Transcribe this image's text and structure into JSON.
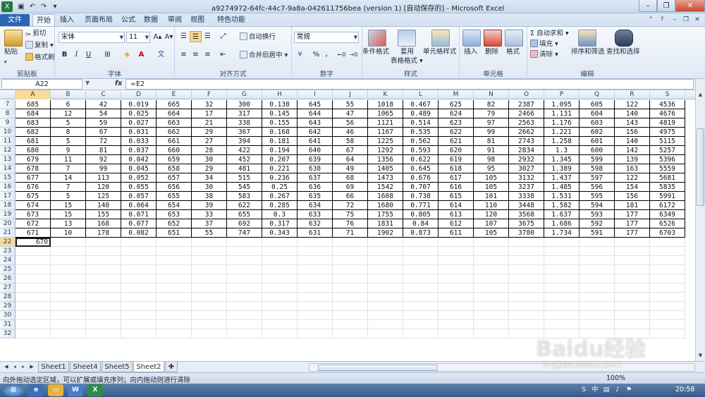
{
  "window": {
    "title": "a9274972-64fc-44c7-9a8a-042611756bea (version 1) [自动保存的] - Microsoft Excel",
    "minimize": "–",
    "restore": "❐",
    "close": "✕"
  },
  "tabs": [
    "文件",
    "开始",
    "插入",
    "页面布局",
    "公式",
    "数据",
    "审阅",
    "视图",
    "特色功能"
  ],
  "active_tab": "开始",
  "ribbon": {
    "clipboard": {
      "paste": "粘贴",
      "cut": "剪切",
      "copy": "复制 ▾",
      "format_painter": "格式刷",
      "label": "剪贴板"
    },
    "font": {
      "name": "宋体",
      "size": "11",
      "grow": "A▴",
      "shrink": "A▾",
      "bold": "B",
      "italic": "I",
      "underline": "U",
      "label": "字体"
    },
    "alignment": {
      "wrap": "自动换行",
      "merge": "合并后居中 ▾",
      "label": "对齐方式"
    },
    "number": {
      "format": "常规",
      "percent": "%",
      "comma": "，",
      "label": "数字"
    },
    "styles": {
      "conditional": "条件格式",
      "table": "套用",
      "table2": "表格格式 ▾",
      "cell_styles": "单元格样式",
      "label": "样式"
    },
    "cells": {
      "insert": "插入",
      "delete": "删除",
      "format": "格式",
      "label": "单元格"
    },
    "editing": {
      "autosum": "Σ 自动求和 ▾",
      "fill": "填充 ▾",
      "clear": "清除 ▾",
      "sort": "排序和筛选",
      "find": "查找和选择",
      "label": "编辑"
    }
  },
  "formula_bar": {
    "name_box": "A22",
    "fx": "fx",
    "formula": "=E2"
  },
  "columns": [
    "A",
    "B",
    "C",
    "D",
    "E",
    "F",
    "G",
    "H",
    "I",
    "J",
    "K",
    "L",
    "M",
    "N",
    "O",
    "P",
    "Q",
    "R",
    "S"
  ],
  "rows": [
    [
      "685",
      "6",
      "42",
      "0.019",
      "665",
      "32",
      "300",
      "0.138",
      "645",
      "55",
      "1018",
      "0.467",
      "625",
      "82",
      "2387",
      "1.095",
      "605",
      "122",
      "4536"
    ],
    [
      "684",
      "12",
      "54",
      "0.025",
      "664",
      "17",
      "317",
      "0.145",
      "644",
      "47",
      "1065",
      "0.489",
      "624",
      "79",
      "2466",
      "1.131",
      "604",
      "140",
      "4676"
    ],
    [
      "683",
      "5",
      "59",
      "0.027",
      "663",
      "21",
      "338",
      "0.155",
      "643",
      "56",
      "1121",
      "0.514",
      "623",
      "97",
      "2563",
      "1.176",
      "603",
      "143",
      "4819"
    ],
    [
      "682",
      "8",
      "67",
      "0.031",
      "662",
      "29",
      "367",
      "0.168",
      "642",
      "46",
      "1167",
      "0.535",
      "622",
      "99",
      "2662",
      "1.221",
      "602",
      "156",
      "4975"
    ],
    [
      "681",
      "5",
      "72",
      "0.033",
      "661",
      "27",
      "394",
      "0.181",
      "641",
      "58",
      "1225",
      "0.562",
      "621",
      "81",
      "2743",
      "1.258",
      "601",
      "140",
      "5115"
    ],
    [
      "680",
      "9",
      "81",
      "0.037",
      "660",
      "28",
      "422",
      "0.194",
      "640",
      "67",
      "1292",
      "0.593",
      "620",
      "91",
      "2834",
      "1.3",
      "600",
      "142",
      "5257"
    ],
    [
      "679",
      "11",
      "92",
      "0.042",
      "659",
      "30",
      "452",
      "0.207",
      "639",
      "64",
      "1356",
      "0.622",
      "619",
      "98",
      "2932",
      "1.345",
      "599",
      "139",
      "5396"
    ],
    [
      "678",
      "7",
      "99",
      "0.045",
      "658",
      "29",
      "481",
      "0.221",
      "638",
      "49",
      "1405",
      "0.645",
      "618",
      "95",
      "3027",
      "1.389",
      "598",
      "163",
      "5559"
    ],
    [
      "677",
      "14",
      "113",
      "0.052",
      "657",
      "34",
      "515",
      "0.236",
      "637",
      "68",
      "1473",
      "0.676",
      "617",
      "105",
      "3132",
      "1.437",
      "597",
      "122",
      "5681"
    ],
    [
      "676",
      "7",
      "120",
      "0.055",
      "656",
      "30",
      "545",
      "0.25",
      "636",
      "69",
      "1542",
      "0.707",
      "616",
      "105",
      "3237",
      "1.485",
      "596",
      "154",
      "5835"
    ],
    [
      "675",
      "5",
      "125",
      "0.057",
      "655",
      "38",
      "583",
      "0.267",
      "635",
      "66",
      "1608",
      "0.738",
      "615",
      "101",
      "3338",
      "1.531",
      "595",
      "156",
      "5991"
    ],
    [
      "674",
      "15",
      "140",
      "0.064",
      "654",
      "39",
      "622",
      "0.285",
      "634",
      "72",
      "1680",
      "0.771",
      "614",
      "110",
      "3448",
      "1.582",
      "594",
      "181",
      "6172"
    ],
    [
      "673",
      "15",
      "155",
      "0.071",
      "653",
      "33",
      "655",
      "0.3",
      "633",
      "75",
      "1755",
      "0.805",
      "613",
      "120",
      "3568",
      "1.637",
      "593",
      "177",
      "6349"
    ],
    [
      "672",
      "13",
      "168",
      "0.077",
      "652",
      "37",
      "692",
      "0.317",
      "632",
      "76",
      "1831",
      "0.84",
      "612",
      "107",
      "3675",
      "1.686",
      "592",
      "177",
      "6526"
    ],
    [
      "671",
      "10",
      "178",
      "0.082",
      "651",
      "55",
      "747",
      "0.343",
      "631",
      "71",
      "1902",
      "0.873",
      "611",
      "105",
      "3780",
      "1.734",
      "591",
      "177",
      "6703"
    ]
  ],
  "first_row_number": 7,
  "active_cell": {
    "row": 22,
    "value": "670"
  },
  "blank_rows": [
    23,
    24,
    25,
    26,
    27,
    28,
    29,
    30,
    31,
    32
  ],
  "sheets": [
    "Sheet1",
    "Sheet4",
    "Sheet5",
    "Sheet2"
  ],
  "active_sheet": "Sheet2",
  "status": {
    "message": "向外拖动选定区域，可以扩展或填充序列；向内拖动则进行清除",
    "zoom": "100%"
  },
  "taskbar": {
    "clock": "20:58",
    "word": "W",
    "excel": "X"
  },
  "watermark": {
    "line1": "Baidu经验",
    "line2": "jingyan.baidu.com"
  }
}
